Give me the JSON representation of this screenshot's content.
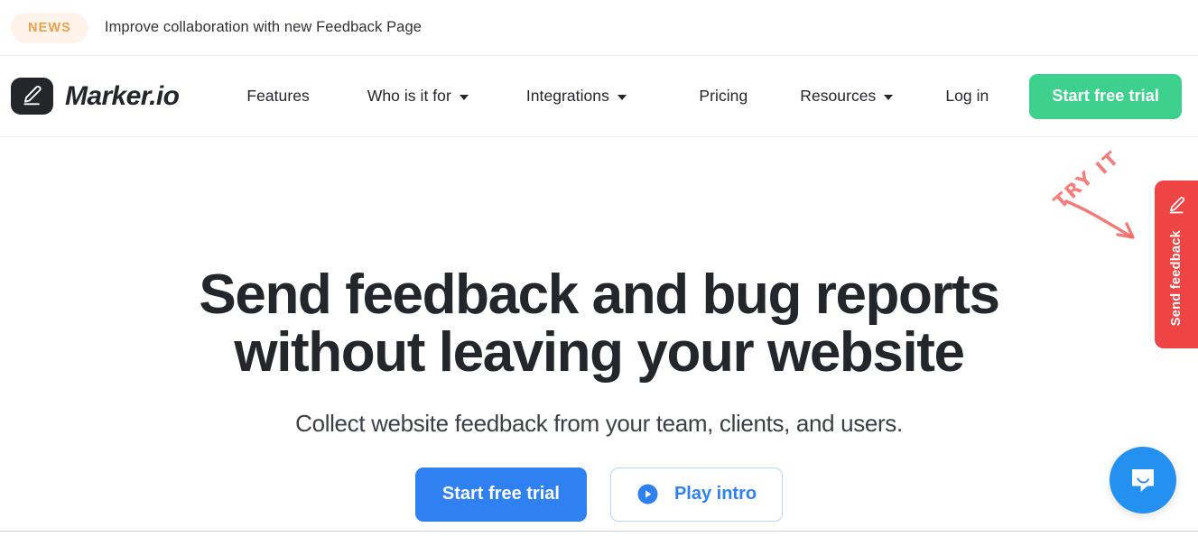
{
  "news": {
    "badge": "NEWS",
    "headline": "Improve collaboration with new Feedback Page"
  },
  "nav": {
    "brand": "Marker.io",
    "brand_icon": "pencil-logo-icon",
    "left_items": [
      {
        "label": "Features",
        "has_caret": false
      },
      {
        "label": "Who is it for",
        "has_caret": true
      },
      {
        "label": "Integrations",
        "has_caret": true
      }
    ],
    "right_items": [
      {
        "label": "Pricing",
        "has_caret": false
      },
      {
        "label": "Resources",
        "has_caret": true
      },
      {
        "label": "Log in",
        "has_caret": false
      }
    ],
    "cta": "Start free trial"
  },
  "hero": {
    "title_line1": "Send feedback and bug reports",
    "title_line2": "without leaving your website",
    "subtitle": "Collect website feedback from your team, clients, and users.",
    "primary_cta": "Start free trial",
    "secondary_cta": "Play intro",
    "secondary_icon": "play-circle-icon"
  },
  "annotation": {
    "word1": "TRY",
    "word2": "IT",
    "arrow_icon": "curved-arrow-icon"
  },
  "feedback_tab": {
    "label": "Send feedback",
    "icon": "pencil-icon"
  },
  "chat": {
    "icon": "chat-bubble-icon"
  },
  "colors": {
    "brand_dark": "#23262b",
    "green": "#3ed18d",
    "blue": "#2f80f0",
    "red": "#ef4444",
    "annotation_red": "#f0635f",
    "news_badge_bg": "#fdf3ea",
    "news_badge_text": "#e8a24c",
    "intercom_blue": "#2490ef"
  }
}
